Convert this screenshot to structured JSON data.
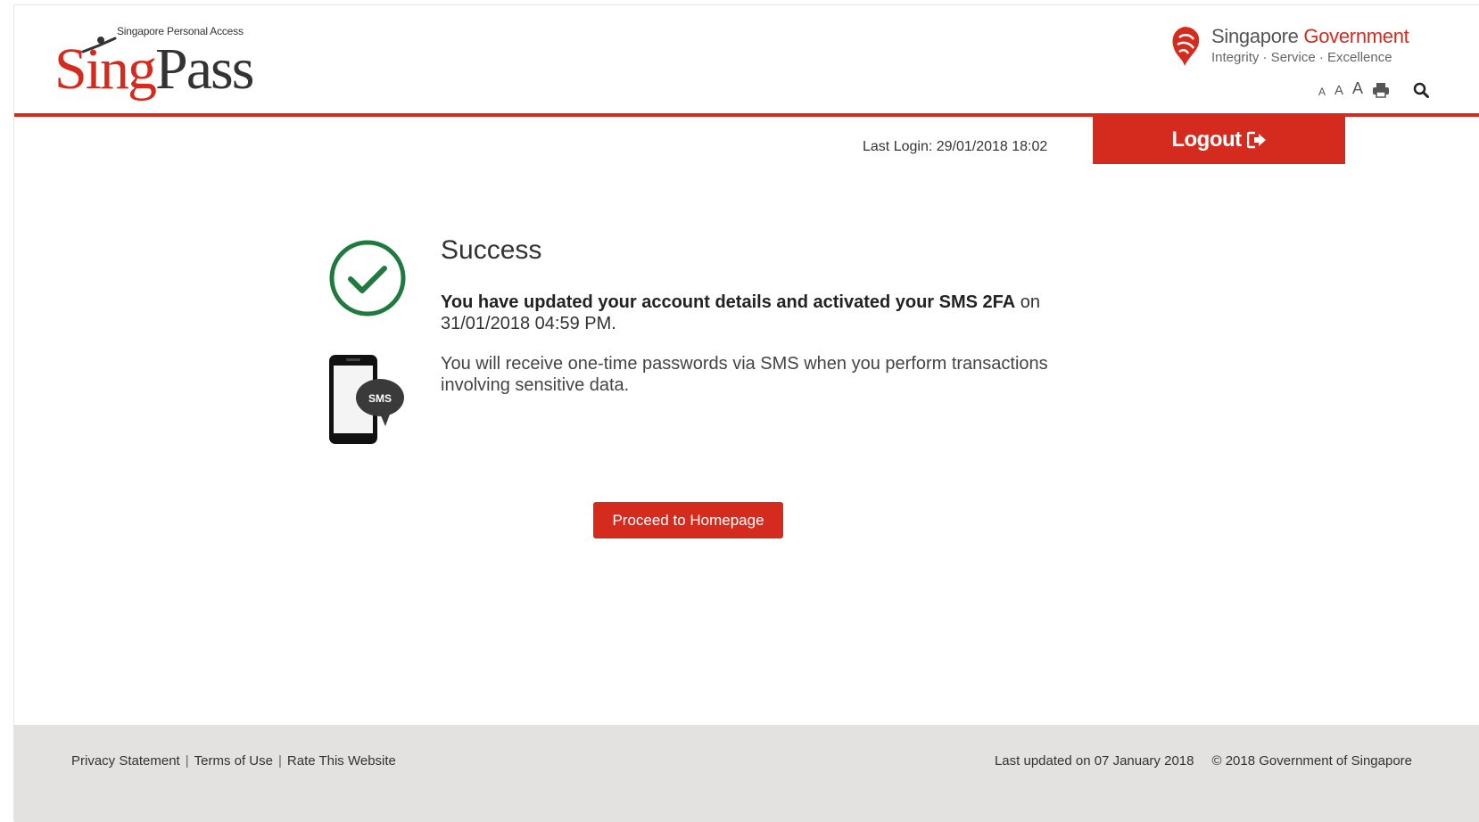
{
  "header": {
    "logo_tagline": "Singapore Personal Access",
    "logo_sing": "Sing",
    "logo_pass": "Pass",
    "gov_title_1": "Singapore ",
    "gov_title_2": "Government",
    "gov_motto": "Integrity · Service · Excellence",
    "font_sizes": [
      "A",
      "A",
      "A"
    ],
    "icons": [
      "print-icon",
      "search-icon"
    ]
  },
  "session": {
    "last_login": "Last Login: 29/01/2018 18:02",
    "logout_label": "Logout"
  },
  "main": {
    "title": "Success",
    "message_bold": "You have updated your account details and activated your SMS 2FA",
    "message_rest": " on 31/01/2018 04:59 PM.",
    "sms_info": "You will receive one-time passwords via SMS when you perform transactions involving sensitive data.",
    "sms_badge": "SMS",
    "proceed_label": "Proceed to Homepage"
  },
  "footer": {
    "links": [
      "Privacy Statement",
      "Terms of Use",
      "Rate This Website"
    ],
    "separator": "|",
    "last_updated": "Last updated on 07 January 2018",
    "copyright": "© 2018 Government of Singapore"
  },
  "colors": {
    "brand_red": "#d52b1e",
    "success_green": "#1f7a3e",
    "footer_bg": "#e4e1e1"
  }
}
